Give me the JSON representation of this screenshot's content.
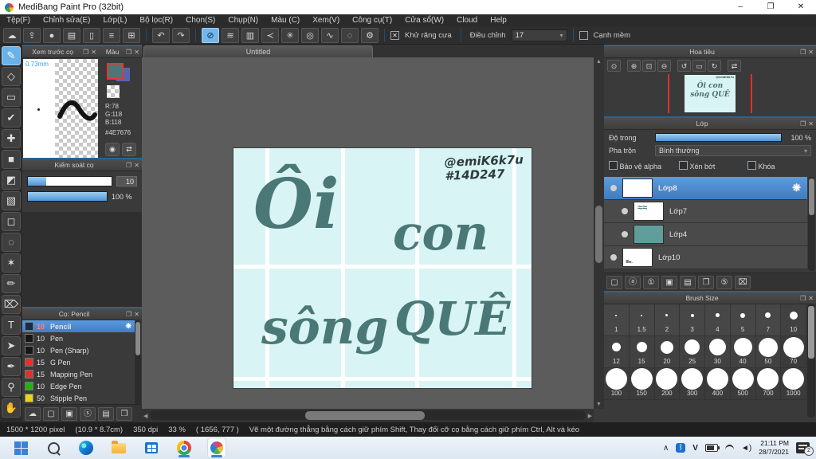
{
  "window": {
    "title": "MediBang Paint Pro (32bit)",
    "minimize": "–",
    "restore": "❐",
    "close": "✕"
  },
  "menu_items": [
    {
      "label": "Tệp(F)"
    },
    {
      "label": "Chỉnh sửa(E)"
    },
    {
      "label": "Lớp(L)"
    },
    {
      "label": "Bộ lọc(R)"
    },
    {
      "label": "Chọn(S)"
    },
    {
      "label": "Chụp(N)"
    },
    {
      "label": "Màu (C)"
    },
    {
      "label": "Xem(V)"
    },
    {
      "label": "Công cụ(T)"
    },
    {
      "label": "Cửa sổ(W)"
    },
    {
      "label": "Cloud"
    },
    {
      "label": "Help"
    }
  ],
  "toolbar": {
    "file_icons": [
      {
        "name": "cloud-icon",
        "glyph": "☁"
      },
      {
        "name": "upload-icon",
        "glyph": "⇪"
      },
      {
        "name": "comment-icon",
        "glyph": "●"
      },
      {
        "name": "comment-lines-icon",
        "glyph": "▤"
      },
      {
        "name": "document-icon",
        "glyph": "▯"
      },
      {
        "name": "list-settings-icon",
        "glyph": "≡"
      },
      {
        "name": "window-layout-icon",
        "glyph": "⊞"
      }
    ],
    "history_icons": [
      {
        "name": "undo-icon",
        "glyph": "↶"
      },
      {
        "name": "redo-icon",
        "glyph": "↷"
      }
    ],
    "snap_icons": [
      {
        "name": "snap-off-icon",
        "glyph": "⊘",
        "cls": "selected"
      },
      {
        "name": "snap-parallel-icon",
        "glyph": "≋"
      },
      {
        "name": "snap-grid-icon",
        "glyph": "▥"
      },
      {
        "name": "snap-vanishing-icon",
        "glyph": "≺"
      },
      {
        "name": "snap-radial-icon",
        "glyph": "✳"
      },
      {
        "name": "snap-concentric-icon",
        "glyph": "◎"
      },
      {
        "name": "snap-curve-icon",
        "glyph": "∿"
      },
      {
        "name": "snap-ellipse-icon",
        "glyph": "◌"
      },
      {
        "name": "snap-settings-icon",
        "glyph": "⚙"
      }
    ],
    "antialias_label": "Khử răng cưa",
    "antialias_mark": "✕",
    "adjust_label": "Điều chỉnh",
    "adjust_value": "17",
    "adjust_arrow": "▾",
    "soft_edge_label": "Cạnh mềm"
  },
  "tools": [
    {
      "name": "brush-tool",
      "glyph": "✎",
      "cls": "selected"
    },
    {
      "name": "eraser-tool",
      "glyph": "◇"
    },
    {
      "name": "rect-tool",
      "glyph": "▭"
    },
    {
      "name": "polyline-tool",
      "glyph": "✔"
    },
    {
      "name": "move-tool",
      "glyph": "✚"
    },
    {
      "name": "fill-rect-tool",
      "glyph": "■"
    },
    {
      "name": "bucket-tool",
      "glyph": "◩"
    },
    {
      "name": "gradient-tool",
      "glyph": "▧"
    },
    {
      "name": "select-tool",
      "glyph": "◻"
    },
    {
      "name": "lasso-tool",
      "glyph": "◌"
    },
    {
      "name": "magic-wand-tool",
      "glyph": "✶"
    },
    {
      "name": "select-pen-tool",
      "glyph": "✏"
    },
    {
      "name": "select-eraser-tool",
      "glyph": "⌦"
    },
    {
      "name": "text-tool",
      "glyph": "T"
    },
    {
      "name": "operation-tool",
      "glyph": "➤"
    },
    {
      "name": "divide-tool",
      "glyph": "✒"
    },
    {
      "name": "eyedropper-tool",
      "glyph": "⚲"
    },
    {
      "name": "hand-tool",
      "glyph": "✋"
    }
  ],
  "panel_icons": {
    "popout": "❐",
    "close": "✕"
  },
  "preview_panel": {
    "title": "Xem trước cọ",
    "size_label": "0.73mm"
  },
  "color_panel": {
    "title": "Màu",
    "r": "R:78",
    "g": "G:118",
    "b": "B:118",
    "hex": "#4E7676",
    "fg_color": "#4E7676",
    "bg_color": "#5A63B2",
    "wheel_icon": "◉",
    "swap_icon": "⇄"
  },
  "brush_control": {
    "title": "Kiểm soát cọ",
    "size_value": "10",
    "size_pct": 22,
    "opacity_value": "100 %",
    "opacity_pct": 100
  },
  "brush_panel": {
    "title": "Cọ: Pencil",
    "brushes": [
      {
        "size": "10",
        "name": "Pencil",
        "color": "#1d2b3d",
        "cls": "selected",
        "gear": "❋"
      },
      {
        "size": "10",
        "name": "Pen",
        "color": "#161616",
        "gear": ""
      },
      {
        "size": "10",
        "name": "Pen (Sharp)",
        "color": "#161616",
        "gear": ""
      },
      {
        "size": "15",
        "name": "G Pen",
        "color": "#e03030",
        "gear": ""
      },
      {
        "size": "15",
        "name": "Mapping Pen",
        "color": "#e03030",
        "gear": ""
      },
      {
        "size": "10",
        "name": "Edge Pen",
        "color": "#22b014",
        "gear": ""
      },
      {
        "size": "50",
        "name": "Stipple Pen",
        "color": "#e8d518",
        "gear": ""
      }
    ],
    "footer_icons": [
      {
        "name": "upload-brush-icon",
        "glyph": "☁"
      },
      {
        "name": "new-brush-icon",
        "glyph": "▢"
      },
      {
        "name": "new-brush-menu-icon",
        "glyph": "▣"
      },
      {
        "name": "script-brush-icon",
        "glyph": "ⓢ"
      },
      {
        "name": "brush-folder-icon",
        "glyph": "▤"
      },
      {
        "name": "duplicate-brush-icon",
        "glyph": "❐"
      }
    ]
  },
  "canvas": {
    "tab": "Untitled",
    "word1": "Ôi",
    "word2": "con",
    "word3": "sông",
    "word4": "QUÊ",
    "signature_line1": "@emiK6k7u",
    "signature_line2": "#14D247",
    "mini_line1": "Ôi  con",
    "mini_line2": "sông QUÊ"
  },
  "navigator": {
    "title": "Hoa tiêu",
    "icons": [
      {
        "name": "zoom-actual-icon",
        "glyph": "⊙"
      },
      {
        "name": "zoom-in-icon",
        "glyph": "⊕",
        "cls": "gap"
      },
      {
        "name": "fit-screen-icon",
        "glyph": "⊡"
      },
      {
        "name": "zoom-out-icon",
        "glyph": "⊖"
      },
      {
        "name": "rotate-ccw-icon",
        "glyph": "↺",
        "cls": "gap"
      },
      {
        "name": "reset-rotation-icon",
        "glyph": "▭"
      },
      {
        "name": "rotate-cw-icon",
        "glyph": "↻"
      },
      {
        "name": "flip-icon",
        "glyph": "⇄",
        "cls": "gap"
      }
    ]
  },
  "layers_panel": {
    "title": "Lớp",
    "opacity_label": "Độ trong",
    "opacity_value": "100 %",
    "blend_label": "Pha trộn",
    "blend_value": "Bình thường",
    "blend_arrow": "▾",
    "checks": [
      {
        "label": "Bảo vệ alpha",
        "cls": "c1"
      },
      {
        "label": "Xén bớt",
        "cls": "c2"
      },
      {
        "label": "Khóa",
        "cls": "c3"
      }
    ],
    "layers": [
      {
        "name": "Lớp8",
        "cls": "selected",
        "thumb": "t-checker",
        "gear": "❋"
      },
      {
        "name": "Lớp7",
        "cls": "indent",
        "thumb": "t-strokes",
        "gear": ""
      },
      {
        "name": "Lớp4",
        "cls": "indent",
        "thumb": "t-teal",
        "gear": ""
      },
      {
        "name": "Lớp10",
        "cls": "",
        "thumb": "t-mark",
        "gear": ""
      }
    ],
    "footer_icons": [
      {
        "name": "new-layer-icon",
        "glyph": "▢"
      },
      {
        "name": "new-8bit-layer-icon",
        "glyph": "ⓐ"
      },
      {
        "name": "new-1bit-layer-icon",
        "glyph": "①"
      },
      {
        "name": "add-layer-menu-icon",
        "glyph": "▣"
      },
      {
        "name": "new-folder-icon",
        "glyph": "▤"
      },
      {
        "name": "duplicate-layer-icon",
        "glyph": "❐"
      },
      {
        "name": "merge-layer-icon",
        "glyph": "⑤"
      },
      {
        "name": "delete-layer-icon",
        "glyph": "⌧"
      }
    ]
  },
  "brush_size_panel": {
    "title": "Brush Size",
    "sizes": [
      {
        "label": "1",
        "d": 2
      },
      {
        "label": "1.5",
        "d": 2
      },
      {
        "label": "2",
        "d": 3
      },
      {
        "label": "3",
        "d": 4
      },
      {
        "label": "4",
        "d": 5
      },
      {
        "label": "5",
        "d": 6
      },
      {
        "label": "7",
        "d": 7
      },
      {
        "label": "10",
        "d": 10
      },
      {
        "label": "12",
        "d": 11
      },
      {
        "label": "15",
        "d": 13
      },
      {
        "label": "20",
        "d": 16
      },
      {
        "label": "25",
        "d": 19
      },
      {
        "label": "30",
        "d": 21
      },
      {
        "label": "40",
        "d": 23
      },
      {
        "label": "50",
        "d": 24
      },
      {
        "label": "70",
        "d": 26
      },
      {
        "label": "100",
        "d": 27
      },
      {
        "label": "150",
        "d": 27
      },
      {
        "label": "200",
        "d": 27
      },
      {
        "label": "300",
        "d": 27
      },
      {
        "label": "400",
        "d": 27
      },
      {
        "label": "500",
        "d": 27
      },
      {
        "label": "700",
        "d": 27
      },
      {
        "label": "1000",
        "d": 27
      }
    ]
  },
  "status": {
    "dims": "1500 * 1200 pixel",
    "cm": "(10.9 * 8.7cm)",
    "dpi": "350 dpi",
    "zoom": "33 %",
    "coords": "( 1656, 777 )",
    "hint": "Vẽ một đường thẳng bằng cách giữ phím Shift, Thay đổi cỡ cọ bằng cách giữ phím Ctrl, Alt và kéo"
  },
  "taskbar": {
    "tray_chevron": "∧",
    "bluetooth": "ᛒ",
    "tray_v": "V",
    "speaker": "◄)",
    "time": "21:11 PM",
    "date": "28/7/2021",
    "badge": "2"
  }
}
